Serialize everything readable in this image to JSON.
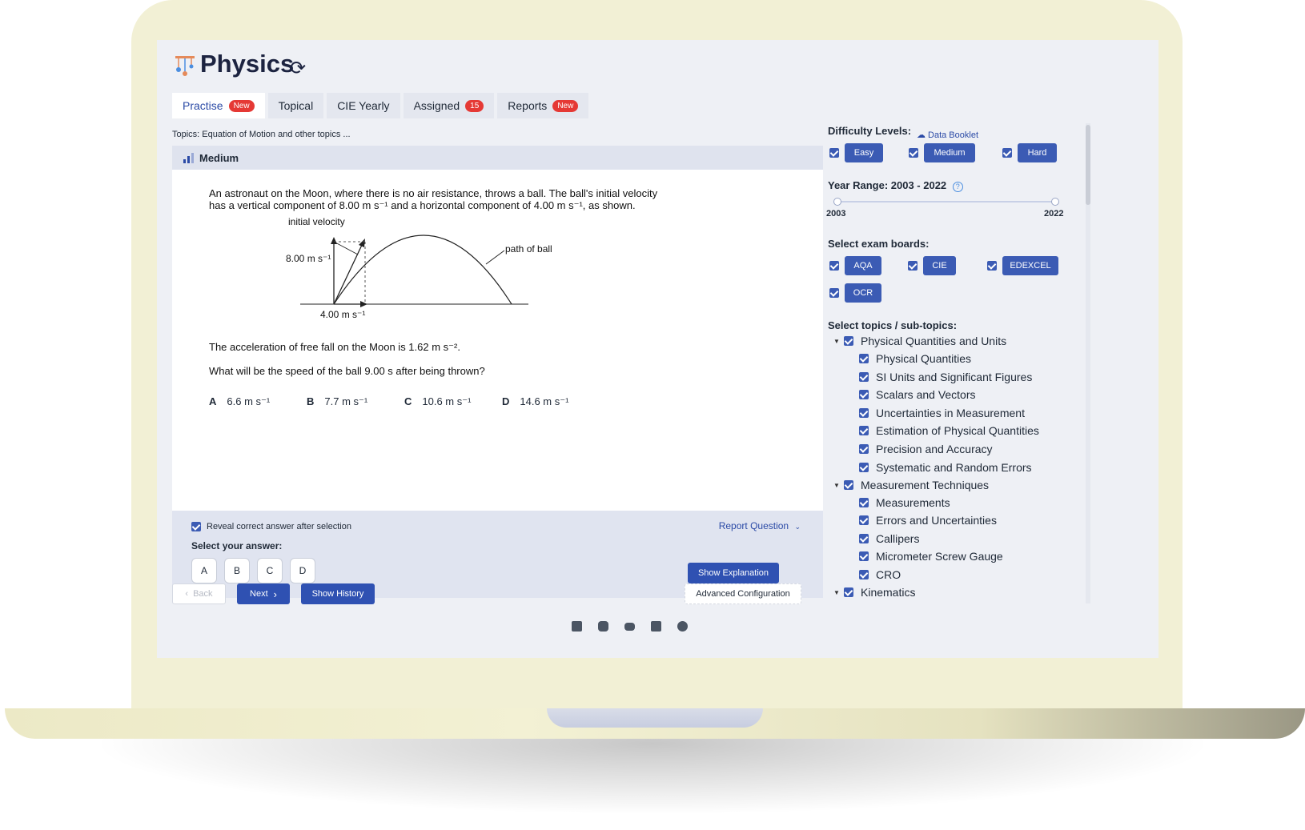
{
  "app": {
    "title": "Physics"
  },
  "tabs": [
    {
      "label": "Practise",
      "badge": "New"
    },
    {
      "label": "Topical"
    },
    {
      "label": "CIE Yearly"
    },
    {
      "label": "Assigned",
      "badge": "15"
    },
    {
      "label": "Reports",
      "badge": "New"
    }
  ],
  "question": {
    "topics": "Topics: Equation of Motion and other topics ...",
    "data_booklet": "Data Booklet",
    "difficulty": "Medium",
    "text_line1": "An astronaut on the Moon, where there is no air resistance, throws a ball. The ball's initial velocity",
    "text_line2": "has a vertical component of 8.00 m s⁻¹ and a horizontal component of 4.00 m s⁻¹, as shown.",
    "diagram": {
      "initial_velocity": "initial velocity",
      "vertical": "8.00 m s⁻¹",
      "horizontal": "4.00 m s⁻¹",
      "path": "path of ball"
    },
    "acceleration_text": "The acceleration of free fall on the Moon is 1.62 m s⁻².",
    "prompt": "What will be the speed of the ball 9.00 s after being thrown?",
    "options": [
      {
        "letter": "A",
        "value": "6.6 m s⁻¹"
      },
      {
        "letter": "B",
        "value": "7.7 m s⁻¹"
      },
      {
        "letter": "C",
        "value": "10.6 m s⁻¹"
      },
      {
        "letter": "D",
        "value": "14.6 m s⁻¹"
      }
    ]
  },
  "answer_panel": {
    "reveal_label": "Reveal correct answer after selection",
    "reveal_checked": true,
    "report_label": "Report Question",
    "select_label": "Select your answer:",
    "answers": [
      "A",
      "B",
      "C",
      "D"
    ],
    "show_explanation": "Show Explanation"
  },
  "footer": {
    "back": "Back",
    "next": "Next",
    "show_history": "Show History",
    "advanced": "Advanced Configuration"
  },
  "social_icons": [
    "facebook-icon",
    "instagram-icon",
    "youtube-icon",
    "linkedin-icon",
    "reddit-icon"
  ],
  "filters": {
    "difficulty_label": "Difficulty Levels:",
    "difficulty": [
      "Easy",
      "Medium",
      "Hard"
    ],
    "year_label": "Year Range: 2003 - 2022",
    "year_min": "2003",
    "year_max": "2022",
    "boards_label": "Select exam boards:",
    "boards": [
      "AQA",
      "CIE",
      "EDEXCEL",
      "OCR"
    ],
    "topics_label": "Select topics / sub-topics:",
    "topics": [
      {
        "label": "Physical Quantities and Units",
        "level": 0,
        "expanded": true
      },
      {
        "label": "Physical Quantities",
        "level": 1
      },
      {
        "label": "SI Units and Significant Figures",
        "level": 1
      },
      {
        "label": "Scalars and Vectors",
        "level": 1
      },
      {
        "label": "Uncertainties in Measurement",
        "level": 1
      },
      {
        "label": "Estimation of Physical Quantities",
        "level": 1
      },
      {
        "label": "Precision and Accuracy",
        "level": 1
      },
      {
        "label": "Systematic and Random Errors",
        "level": 1
      },
      {
        "label": "Measurement Techniques",
        "level": 0,
        "expanded": true
      },
      {
        "label": "Measurements",
        "level": 1
      },
      {
        "label": "Errors and Uncertainties",
        "level": 1
      },
      {
        "label": "Callipers",
        "level": 1
      },
      {
        "label": "Micrometer Screw Gauge",
        "level": 1
      },
      {
        "label": "CRO",
        "level": 1
      },
      {
        "label": "Kinematics",
        "level": 0,
        "expanded": true
      }
    ]
  },
  "colors": {
    "accent": "#2f51b2",
    "badge": "#e53935",
    "frame": "#f2f0d5"
  }
}
